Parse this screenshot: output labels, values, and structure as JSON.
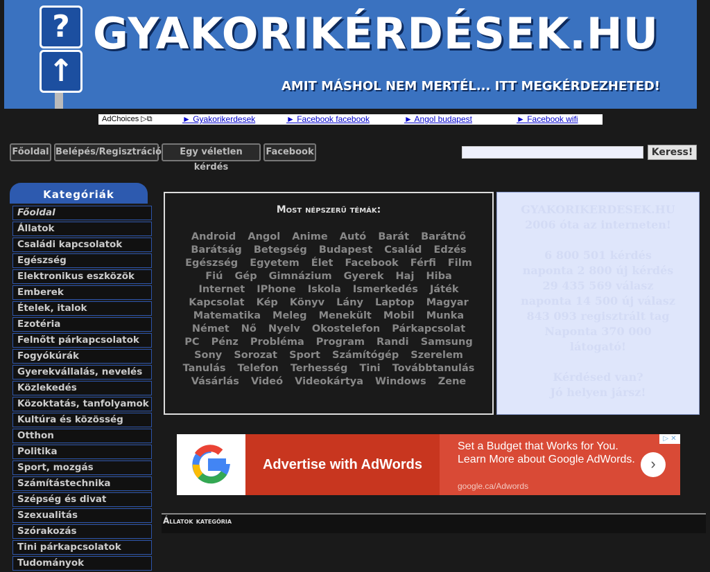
{
  "header": {
    "title": "GYAKORIKÉRDÉSEK.HU",
    "slogan": "AMIT MÁSHOL NEM MERTÉL... ITT MEGKÉRDEZHETED!",
    "sign_top": "?",
    "sign_bottom": "↑"
  },
  "adbar": {
    "adchoices": "AdChoices ▷⧉",
    "links": [
      "► Gyakorikerdesek",
      "► Facebook facebook",
      "► Angol budapest",
      "► Facebook wifi"
    ]
  },
  "nav": {
    "buttons": [
      "Főoldal",
      "Belépés/Regisztráció",
      "Egy véletlen kérdés",
      "Facebook"
    ],
    "search_placeholder": "",
    "search_button": "Keress!"
  },
  "sidebar": {
    "header": "Kategóriák",
    "items": [
      "Főoldal",
      "Állatok",
      "Családi kapcsolatok",
      "Egészség",
      "Elektronikus eszközök",
      "Emberek",
      "Ételek, italok",
      "Ezotéria",
      "Felnőtt párkapcsolatok",
      "Fogyókúrák",
      "Gyerekvállalás, nevelés",
      "Közlekedés",
      "Közoktatás, tanfolyamok",
      "Kultúra és közösség",
      "Otthon",
      "Politika",
      "Sport, mozgás",
      "Számítástechnika",
      "Szépség és divat",
      "Szexualitás",
      "Szórakozás",
      "Tini párkapcsolatok",
      "Tudományok"
    ]
  },
  "popular": {
    "title": "Most népszerű témák:",
    "topics": [
      "Android",
      "Angol",
      "Anime",
      "Autó",
      "Barát",
      "Barátnő",
      "Barátság",
      "Betegség",
      "Budapest",
      "Család",
      "Edzés",
      "Egészség",
      "Egyetem",
      "Élet",
      "Facebook",
      "Férfi",
      "Film",
      "Fiú",
      "Gép",
      "Gimnázium",
      "Gyerek",
      "Haj",
      "Hiba",
      "Internet",
      "IPhone",
      "Iskola",
      "Ismerkedés",
      "Játék",
      "Kapcsolat",
      "Kép",
      "Könyv",
      "Lány",
      "Laptop",
      "Magyar",
      "Matematika",
      "Meleg",
      "Menekült",
      "Mobil",
      "Munka",
      "Német",
      "Nő",
      "Nyelv",
      "Okostelefon",
      "Párkapcsolat",
      "PC",
      "Pénz",
      "Probléma",
      "Program",
      "Randi",
      "Samsung",
      "Sony",
      "Sorozat",
      "Sport",
      "Számítógép",
      "Szerelem",
      "Tanulás",
      "Telefon",
      "Terhesség",
      "Tini",
      "Továbbtanulás",
      "Vásárlás",
      "Videó",
      "Videokártya",
      "Windows",
      "Zene"
    ]
  },
  "stats": {
    "lines": [
      "GYAKORIKERDESEK.HU",
      "2006 óta az interneten!",
      "",
      "6 800 501 kérdés",
      "naponta 2 800 új kérdés",
      "29 435 569 válasz",
      "naponta 14 500 új válasz",
      "843 093 regisztrált tag",
      "Naponta 370 000",
      "látogató!",
      "",
      "Kérdésed van?",
      "Jó helyen jársz!"
    ]
  },
  "ad": {
    "headline": "Advertise with AdWords",
    "body": "Set a Budget that Works for You. Learn More about Google AdWords.",
    "url": "google.ca/Adwords",
    "arrow": "›",
    "info": "▷ ✕"
  },
  "bottom": {
    "title": "Állatok kategória"
  },
  "colors": {
    "background": "#1a1a1a",
    "banner_blue": "#3a72c0",
    "sidebar_border": "#2d55aa",
    "ad_red": "#c8361f",
    "stats_bg": "#dfe6fb"
  }
}
